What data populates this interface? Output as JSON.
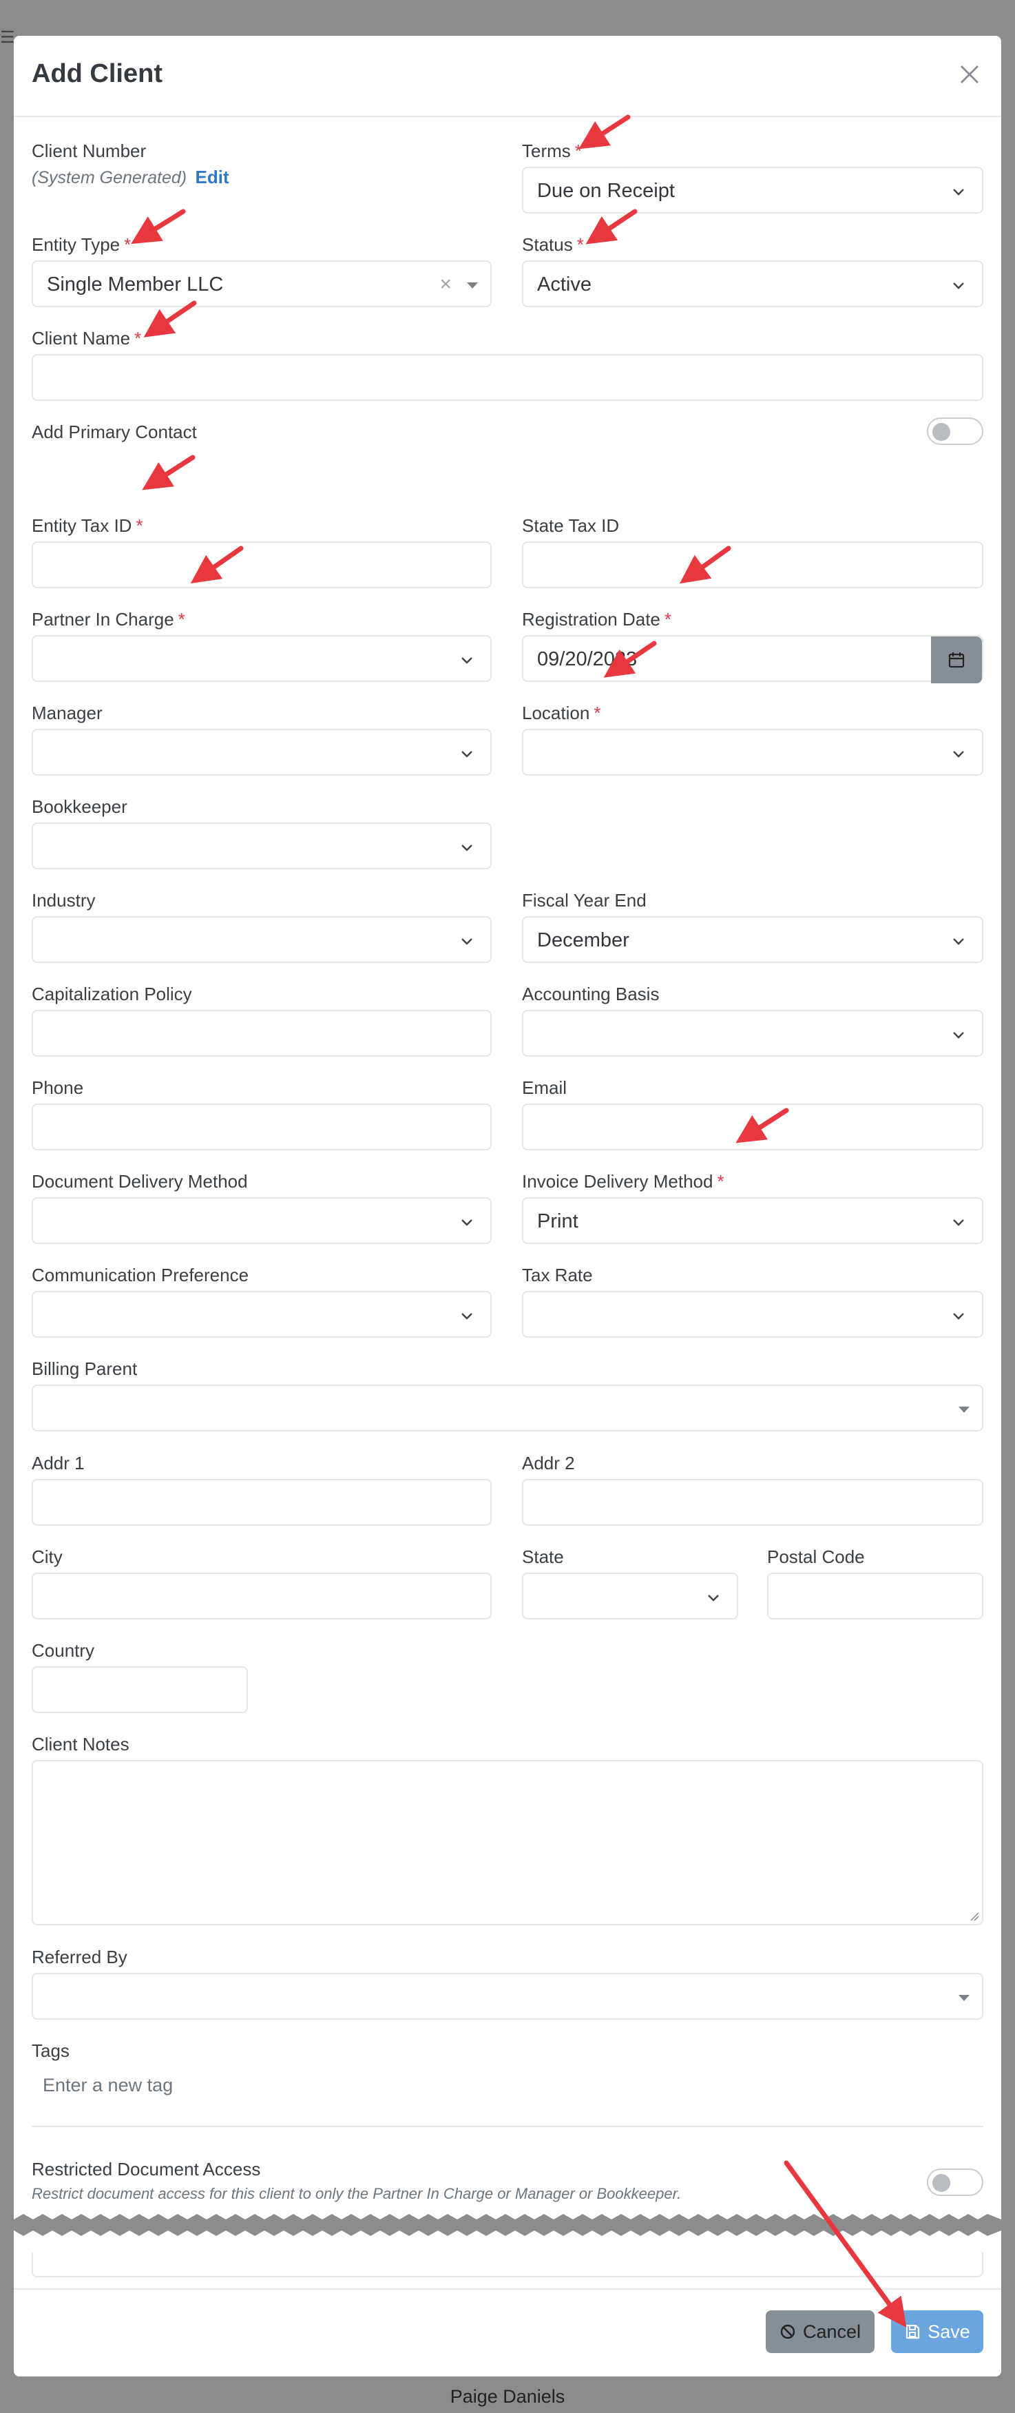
{
  "modal": {
    "title": "Add Client"
  },
  "fields": {
    "client_number": {
      "label": "Client Number",
      "system_text": "(System Generated)",
      "edit_label": "Edit"
    },
    "terms": {
      "label": "Terms",
      "value": "Due on Receipt"
    },
    "entity_type": {
      "label": "Entity Type",
      "value": "Single Member LLC",
      "clear": "×"
    },
    "status": {
      "label": "Status",
      "value": "Active"
    },
    "client_name": {
      "label": "Client Name",
      "value": ""
    },
    "add_primary_contact": {
      "label": "Add Primary Contact",
      "checked": false
    },
    "entity_tax_id": {
      "label": "Entity Tax ID",
      "value": ""
    },
    "state_tax_id": {
      "label": "State Tax ID",
      "value": ""
    },
    "partner_in_charge": {
      "label": "Partner In Charge",
      "value": ""
    },
    "registration_date": {
      "label": "Registration Date",
      "value": "09/20/2023"
    },
    "manager": {
      "label": "Manager",
      "value": ""
    },
    "location": {
      "label": "Location",
      "value": ""
    },
    "bookkeeper": {
      "label": "Bookkeeper",
      "value": ""
    },
    "industry": {
      "label": "Industry",
      "value": ""
    },
    "fiscal_year_end": {
      "label": "Fiscal Year End",
      "value": "December"
    },
    "capitalization_policy": {
      "label": "Capitalization Policy",
      "value": ""
    },
    "accounting_basis": {
      "label": "Accounting Basis",
      "value": ""
    },
    "phone": {
      "label": "Phone",
      "value": ""
    },
    "email": {
      "label": "Email",
      "value": ""
    },
    "document_delivery_method": {
      "label": "Document Delivery Method",
      "value": ""
    },
    "invoice_delivery_method": {
      "label": "Invoice Delivery Method",
      "value": "Print"
    },
    "communication_preference": {
      "label": "Communication Preference",
      "value": ""
    },
    "tax_rate": {
      "label": "Tax Rate",
      "value": ""
    },
    "billing_parent": {
      "label": "Billing Parent",
      "value": ""
    },
    "addr1": {
      "label": "Addr 1",
      "value": ""
    },
    "addr2": {
      "label": "Addr 2",
      "value": ""
    },
    "city": {
      "label": "City",
      "value": ""
    },
    "state": {
      "label": "State",
      "value": ""
    },
    "postal_code": {
      "label": "Postal Code",
      "value": ""
    },
    "country": {
      "label": "Country",
      "value": ""
    },
    "client_notes": {
      "label": "Client Notes",
      "value": ""
    },
    "referred_by": {
      "label": "Referred By",
      "value": ""
    },
    "tags": {
      "label": "Tags",
      "placeholder": "Enter a new tag"
    },
    "restricted_document_access": {
      "label": "Restricted Document Access",
      "help": "Restrict document access for this client to only the Partner In Charge or Manager or Bookkeeper.",
      "checked": false
    }
  },
  "required_marker": "*",
  "footer": {
    "cancel_label": "Cancel",
    "save_label": "Save"
  },
  "background": {
    "user_name": "Paige Daniels"
  },
  "colors": {
    "required": "#e0394f",
    "link": "#2f78c4",
    "save_button": "#6aa5e0",
    "cancel_button": "#868e96",
    "annotation_arrow": "#e8383f"
  }
}
